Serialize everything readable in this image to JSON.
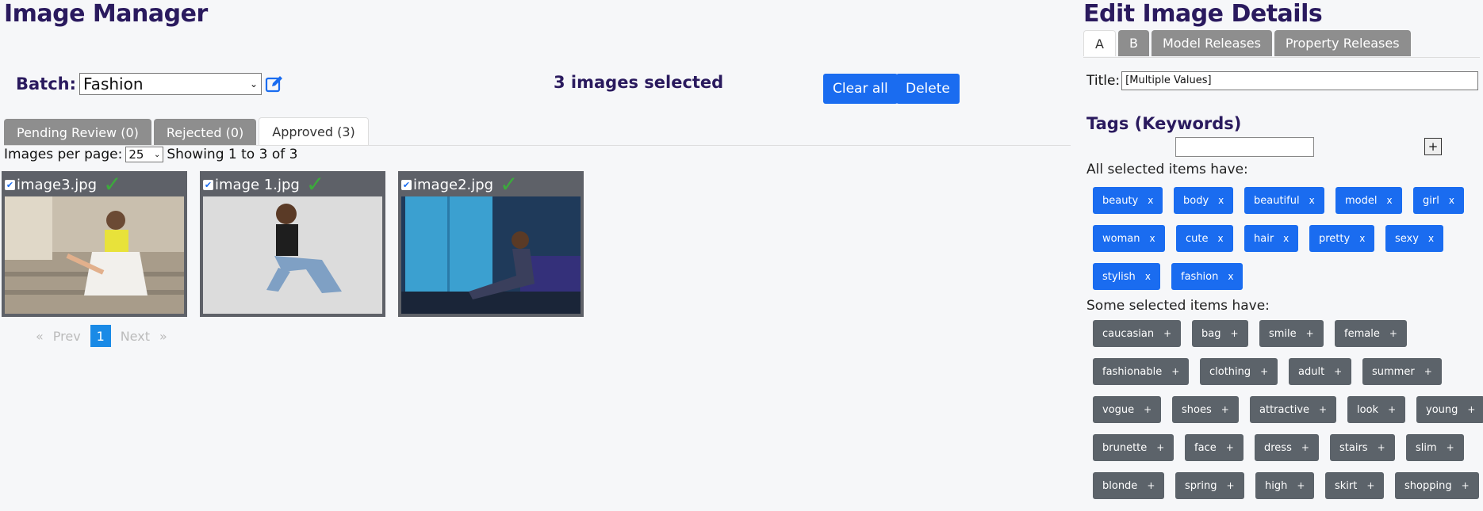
{
  "left": {
    "title": "Image Manager",
    "batch_label": "Batch:",
    "batch_value": "Fashion",
    "selected_text": "3 images selected",
    "clear_all": "Clear all",
    "delete": "Delete",
    "tabs": [
      "Pending Review (0)",
      "Rejected (0)",
      "Approved (3)"
    ],
    "per_page_label": "Images per page:",
    "per_page_value": "25",
    "showing": "Showing 1 to 3 of 3",
    "images": [
      "image3.jpg",
      "image 1.jpg",
      "image2.jpg"
    ],
    "pager": {
      "first": "«",
      "prev": "Prev",
      "page": "1",
      "next": "Next",
      "last": "»"
    }
  },
  "right": {
    "title": "Edit Image Details",
    "tabs": [
      "A",
      "B",
      "Model Releases",
      "Property Releases"
    ],
    "title_label": "Title:",
    "title_value": "[Multiple Values]",
    "tags_heading": "Tags (Keywords)",
    "add_label": "+",
    "all_heading": "All selected items have:",
    "some_heading": "Some selected items have:",
    "all_tags": [
      "beauty",
      "body",
      "beautiful",
      "model",
      "girl",
      "woman",
      "cute",
      "hair",
      "pretty",
      "sexy",
      "stylish",
      "fashion"
    ],
    "some_tags": [
      "caucasian",
      "bag",
      "smile",
      "female",
      "fashionable",
      "clothing",
      "adult",
      "summer",
      "vogue",
      "shoes",
      "attractive",
      "look",
      "young",
      "brunette",
      "face",
      "dress",
      "stairs",
      "slim",
      "blonde",
      "spring",
      "high",
      "skirt",
      "shopping"
    ],
    "remove_symbol": "x",
    "add_symbol": "+"
  },
  "colors": {
    "accent": "#1a6cf0",
    "heading": "#2a1a5e",
    "chip_dark": "#5c636a",
    "tab_grey": "#8e8e8e"
  }
}
